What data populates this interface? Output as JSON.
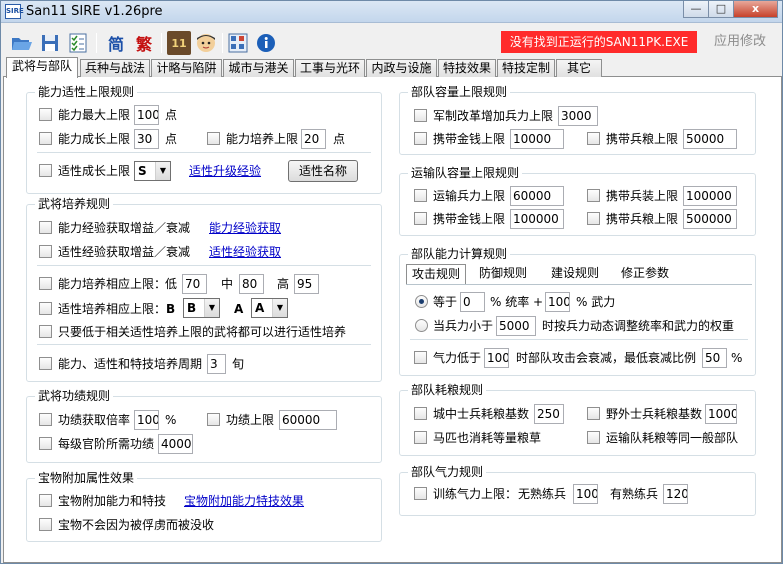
{
  "window": {
    "title": "San11 SIRE v1.26pre",
    "icon_text": "SIRE",
    "min": "—",
    "max": "□",
    "close": "x"
  },
  "toolbar": {
    "simplified": "简",
    "traditional": "繁",
    "status_text": "没有找到正运行的SAN11PK.EXE",
    "apply": "应用修改",
    "eleven": "11"
  },
  "tabs": [
    "武将与部队",
    "兵种与战法",
    "计略与陷阱",
    "城市与港关",
    "工事与光环",
    "内政与设施",
    "特技效果",
    "特技定制",
    "其它"
  ],
  "left": {
    "ability": {
      "title": "能力适性上限规则",
      "max_label": "能力最大上限",
      "max_val": "100",
      "unit": "点",
      "growth_label": "能力成长上限",
      "growth_val": "30",
      "train_label": "能力培养上限",
      "train_val": "20",
      "apt_label": "适性成长上限",
      "apt_val": "S",
      "apt_link": "适性升级经验",
      "apt_name_btn": "适性名称"
    },
    "training": {
      "title": "武将培养规则",
      "r1": "能力经验获取增益／衰减",
      "r1_link": "能力经验获取",
      "r2": "适性经验获取增益／衰减",
      "r2_link": "适性经验获取",
      "r3": "能力培养相应上限：",
      "low": "低",
      "low_val": "70",
      "mid": "中",
      "mid_val": "80",
      "high": "高",
      "high_val": "95",
      "r4": "适性培养相应上限：",
      "b_lbl": "B",
      "b_val": "B",
      "a_lbl": "A",
      "a_val": "A",
      "r5": "只要低于相关适性培养上限的武将都可以进行适性培养",
      "r6": "能力、适性和特技培养周期",
      "period_val": "3",
      "period_unit": "旬"
    },
    "merit": {
      "title": "武将功绩规则",
      "gain_label": "功绩获取倍率",
      "gain_val": "100",
      "pct": "%",
      "cap_label": "功绩上限",
      "cap_val": "60000",
      "rank_label": "每级官阶所需功绩",
      "rank_val": "4000"
    },
    "treasure": {
      "title": "宝物附加属性效果",
      "r1": "宝物附加能力和特技",
      "r1_link": "宝物附加能力特技效果",
      "r2": "宝物不会因为被俘虏而被没收"
    }
  },
  "right": {
    "capacity": {
      "title": "部队容量上限规则",
      "r1": "军制改革增加兵力上限",
      "r1_val": "3000",
      "gold": "携带金钱上限",
      "gold_val": "10000",
      "food": "携带兵粮上限",
      "food_val": "50000"
    },
    "transport": {
      "title": "运输队容量上限规则",
      "troops": "运输兵力上限",
      "troops_val": "60000",
      "arms": "携带兵装上限",
      "arms_val": "100000",
      "gold": "携带金钱上限",
      "gold_val": "100000",
      "food": "携带兵粮上限",
      "food_val": "500000"
    },
    "calc": {
      "title": "部队能力计算规则",
      "subtabs": [
        "攻击规则",
        "防御规则",
        "建设规则",
        "修正参数"
      ],
      "eq": "等于",
      "eq_val": "0",
      "rate": "% 统率 +",
      "rate_val": "100",
      "war": "% 武力",
      "less": "当兵力小于",
      "less_val": "5000",
      "less_tail": "时按兵力动态调整统率和武力的权重",
      "morale": "气力低于",
      "morale_val": "100",
      "morale_mid": "时部队攻击会衰减，最低衰减比例",
      "morale_min": "50",
      "pct": "%"
    },
    "food": {
      "title": "部队耗粮规则",
      "city": "城中士兵耗粮基数",
      "city_val": "250",
      "field": "野外士兵耗粮基数",
      "field_val": "1000",
      "horse": "马匹也消耗等量粮草",
      "trans": "运输队耗粮等同一般部队"
    },
    "morale": {
      "title": "部队气力规则",
      "label": "训练气力上限：",
      "unskilled": "无熟练兵",
      "unskilled_val": "100",
      "skilled": "有熟练兵",
      "skilled_val": "120"
    }
  }
}
